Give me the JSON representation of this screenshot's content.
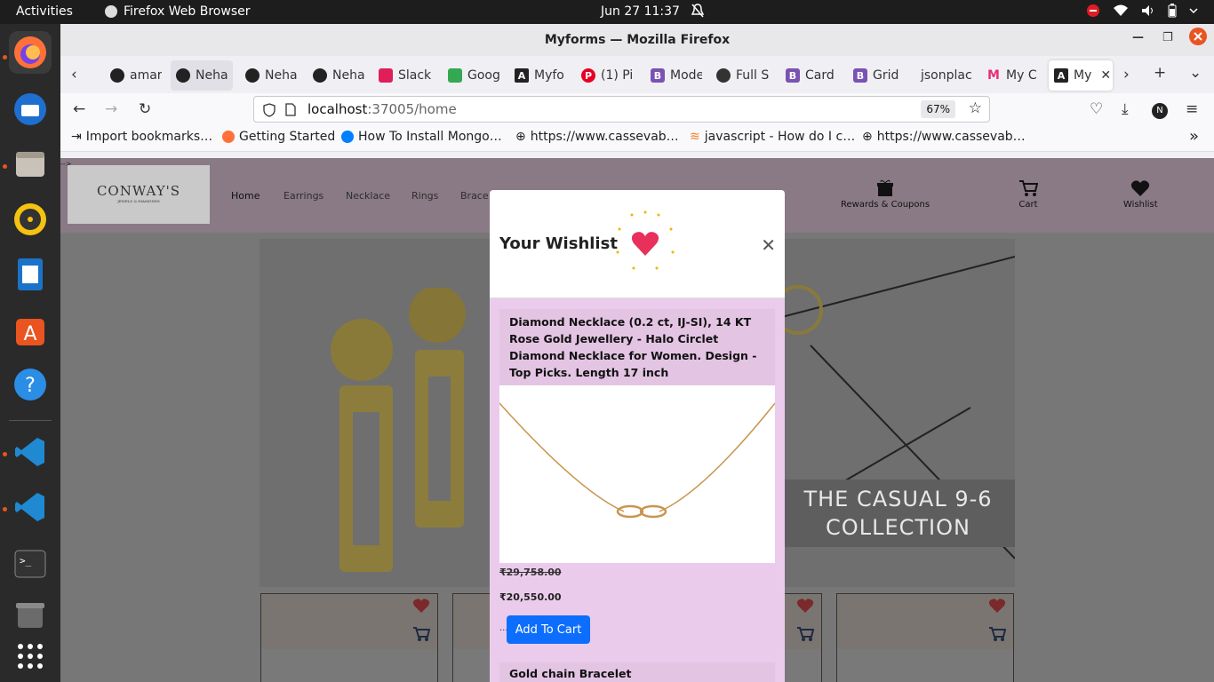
{
  "system": {
    "activities": "Activities",
    "app_name": "Firefox Web Browser",
    "clock": "Jun 27  11:37"
  },
  "window": {
    "title": "Myforms — Mozilla Firefox"
  },
  "tabs": [
    {
      "label": "amar",
      "icon": "github-icon"
    },
    {
      "label": "Neha",
      "icon": "github-icon"
    },
    {
      "label": "Neha",
      "icon": "github-icon"
    },
    {
      "label": "Neha",
      "icon": "github-icon"
    },
    {
      "label": "Slack",
      "icon": "slack-icon"
    },
    {
      "label": "Goog",
      "icon": "google-meet-icon"
    },
    {
      "label": "Myfo",
      "icon": "angular-icon"
    },
    {
      "label": "(1) Pi",
      "icon": "pinterest-icon"
    },
    {
      "label": "Mode",
      "icon": "bootstrap-icon"
    },
    {
      "label": "Full S",
      "icon": "fullstack-icon"
    },
    {
      "label": "Card",
      "icon": "bootstrap-icon"
    },
    {
      "label": "Grid",
      "icon": "bootstrap-icon"
    },
    {
      "label": "jsonplac",
      "icon": ""
    },
    {
      "label": "My C",
      "icon": "myntra-icon"
    },
    {
      "label": "My",
      "icon": "angular-icon"
    }
  ],
  "url": {
    "host": "localhost",
    "path": ":37005/home",
    "zoom": "67%"
  },
  "bookmarks": [
    {
      "label": "Import bookmarks…"
    },
    {
      "label": "Getting Started"
    },
    {
      "label": "How To Install Mongo…"
    },
    {
      "label": "https://www.cassevab…"
    },
    {
      "label": "javascript - How do I c…"
    },
    {
      "label": "https://www.cassevab…"
    }
  ],
  "site": {
    "logo_name": "CONWAY'S",
    "logo_tag": "JEWELS & DIAMONDS",
    "nav": [
      "Home",
      "Earrings",
      "Necklace",
      "Rings",
      "Brace"
    ],
    "rewards": "Rewards & Coupons",
    "cart": "Cart",
    "wishlist": "Wishlist",
    "banner": [
      "THE  CASUAL 9-6",
      "COLLECTION"
    ]
  },
  "modal": {
    "title": "Your Wishlist",
    "items": [
      {
        "name": "Diamond Necklace (0.2 ct, IJ-SI), 14 KT Rose Gold Jewellery - Halo Circlet Diamond Necklace for Women. Design - Top Picks. Length 17 inch",
        "price_old": "₹29,758.00",
        "price_new": "₹20,550.00",
        "button": "Add To Cart"
      },
      {
        "name": "Gold chain Bracelet"
      }
    ]
  },
  "colors": {
    "primary_button": "#0d6efd",
    "wishlist_bg": "#ebcbeb",
    "heart": "#e8305a"
  }
}
